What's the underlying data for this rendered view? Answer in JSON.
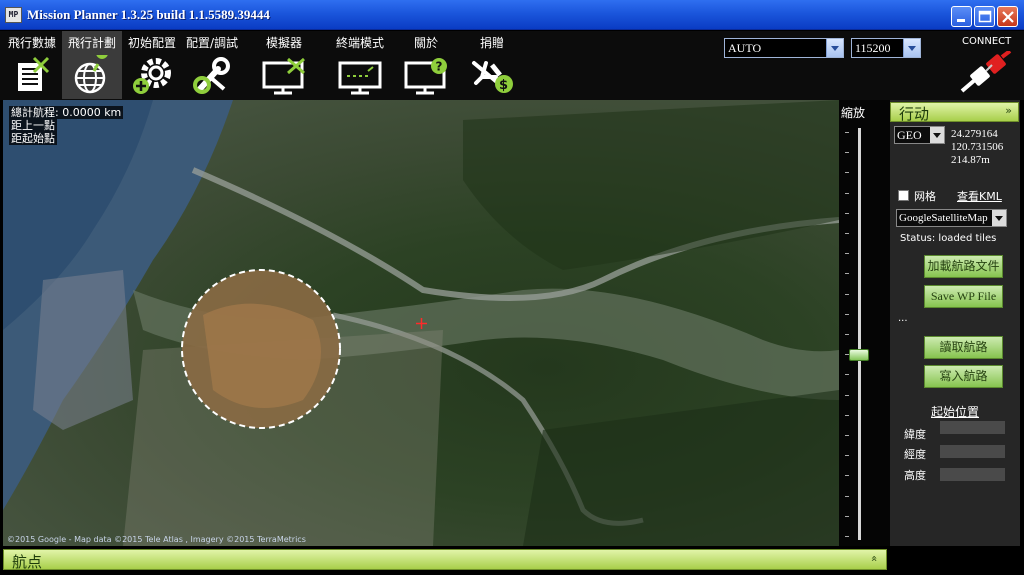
{
  "window": {
    "app_icon": "MP",
    "title": "Mission Planner 1.3.25 build 1.1.5589.39444"
  },
  "menu": [
    {
      "label": "飛行數據",
      "icon": "flight-data-icon"
    },
    {
      "label": "飛行計劃",
      "icon": "flight-plan-icon"
    },
    {
      "label": "初始配置",
      "icon": "initial-setup-icon"
    },
    {
      "label": "配置/調試",
      "icon": "config-tuning-icon"
    },
    {
      "label": "模擬器",
      "icon": "simulation-icon"
    },
    {
      "label": "終端模式",
      "icon": "terminal-icon"
    },
    {
      "label": "關於",
      "icon": "help-icon"
    },
    {
      "label": "捐贈",
      "icon": "donate-icon"
    }
  ],
  "connection": {
    "port_value": "AUTO",
    "baud_value": "115200",
    "connect_label": "CONNECT"
  },
  "map": {
    "total_distance": "總計航程: 0.0000 km",
    "prev_point": "距上一點",
    "home_distance": "距起始點",
    "attribution": "©2015 Google - Map data ©2015 Tele Atlas , Imagery ©2015 TerraMetrics"
  },
  "zoom": {
    "label": "縮放",
    "level": 0.45
  },
  "action_panel": {
    "header": "行动",
    "collapse_glyph": "»",
    "coord_system": "GEO",
    "latitude": "24.279164",
    "longitude": "120.731506",
    "altitude": "214.87m",
    "grid_label": "网格",
    "view_kml": "查看KML",
    "map_provider": "GoogleSatelliteMap",
    "status": "Status: loaded tiles",
    "load_wp_file": "加載航路文件",
    "save_wp_file": "Save WP File",
    "ellipsis": "...",
    "read_wps": "讀取航路",
    "write_wps": "寫入航路",
    "home_location": "起始位置",
    "home_lat_label": "緯度",
    "home_lng_label": "經度",
    "home_alt_label": "高度"
  },
  "bottom_panel": {
    "title": "航点",
    "expand_glyph": "«"
  }
}
